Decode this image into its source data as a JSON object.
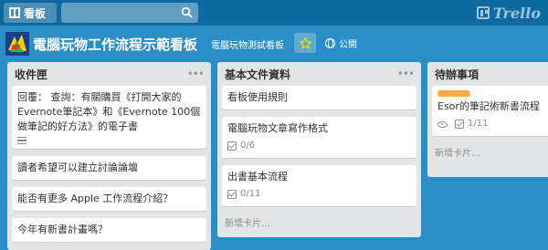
{
  "header": {
    "boards_label": "看板",
    "search_placeholder": "",
    "logo_text": "Trello"
  },
  "board": {
    "title": "電腦玩物工作流程示範看板",
    "org": "電腦玩物測試看板",
    "visibility": "公開"
  },
  "lists": [
    {
      "title": "收件匣",
      "cards": [
        {
          "text": "回覆： 查詢：有關購買《打開大家的Evernote筆記本》和《Evernote 100個做筆記的好方法》的電子書",
          "has_description": true
        },
        {
          "text": "讀者希望可以建立討論論壇"
        },
        {
          "text": "能否有更多 Apple 工作流程介紹？"
        },
        {
          "text": "今年有新書計畫嗎？"
        }
      ]
    },
    {
      "title": "基本文件資料",
      "cards": [
        {
          "text": "看板使用規則"
        },
        {
          "text": "電腦玩物文章寫作格式",
          "checklist": "0/6"
        },
        {
          "text": "出書基本流程",
          "checklist": "0/11"
        }
      ],
      "add_card": "新增卡片…"
    },
    {
      "title": "待辦事項",
      "cards": [
        {
          "text": "Esor的筆記術新書流程",
          "checklist": "1/11",
          "label_color": "#ffab4a",
          "watching": true
        }
      ],
      "add_card": "新增卡片…"
    }
  ],
  "icons": {
    "boards": "boards-icon",
    "search": "search-icon",
    "logo": "trello-logo-icon",
    "star": "star-icon",
    "visibility": "globe-icon",
    "list_menu": "more-icon",
    "description": "description-icon",
    "checklist": "checklist-icon",
    "watch": "eye-icon"
  },
  "colors": {
    "background": "#2b8fc7",
    "topbar": "#0f6aa1",
    "list_bg": "#e2e4e6",
    "star": "#f2d600",
    "label_orange": "#ffab4a"
  }
}
